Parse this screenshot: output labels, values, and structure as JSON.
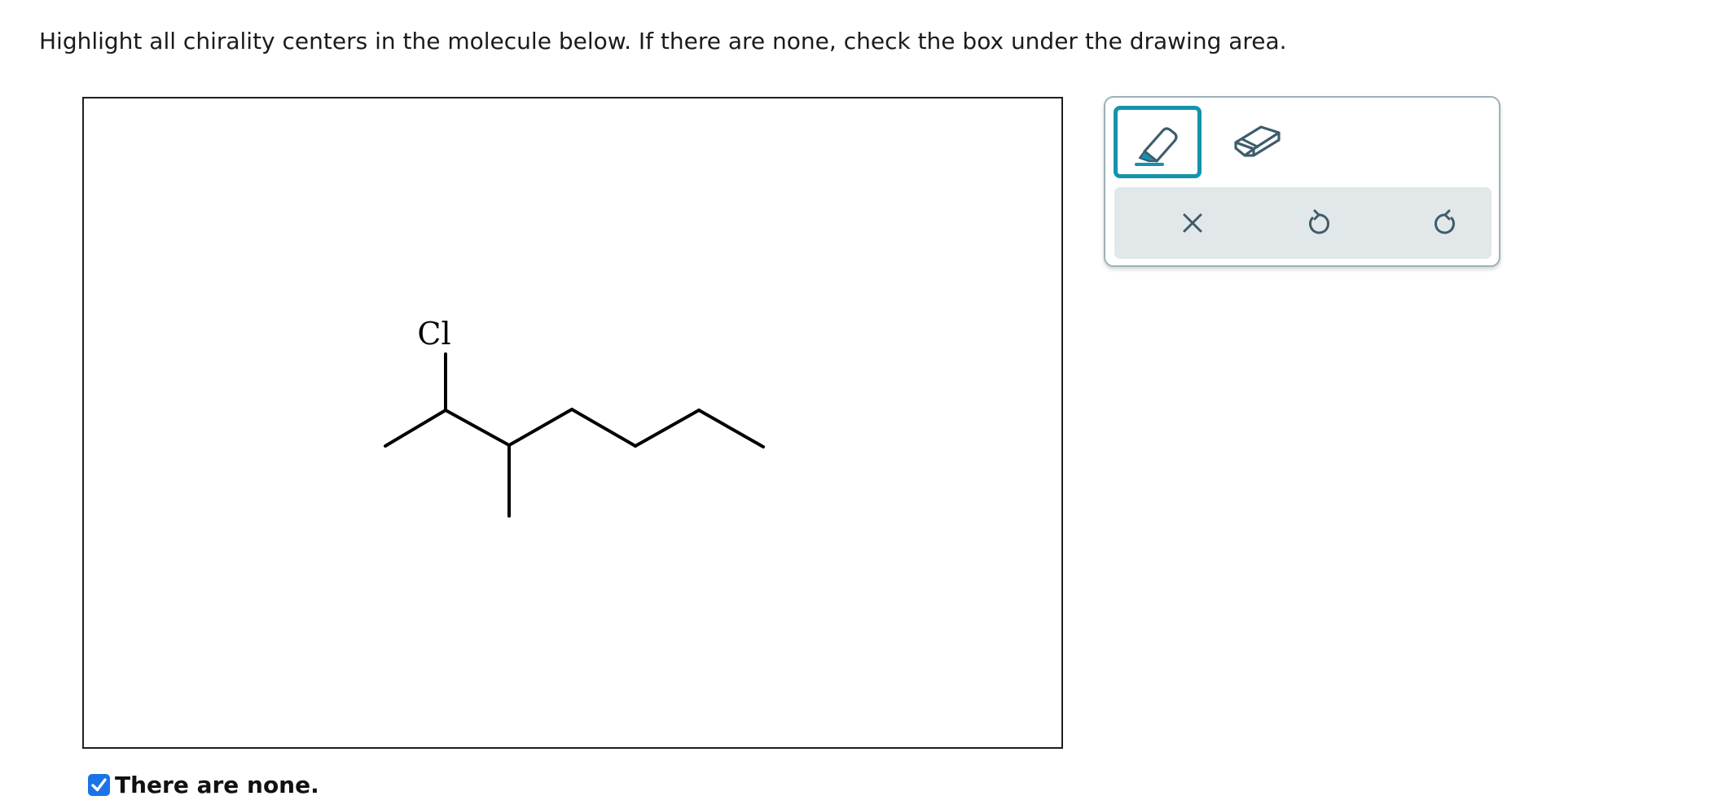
{
  "question": {
    "text": "Highlight all chirality centers in the molecule below. If there are none, check the box under the drawing area."
  },
  "molecule": {
    "atom_labels": [
      "Cl"
    ]
  },
  "none_option": {
    "label": "There are none.",
    "checked": true
  },
  "toolbox": {
    "tools": [
      "highlighter-icon",
      "eraser-icon"
    ],
    "selected_tool": "highlighter",
    "actions": [
      "clear-icon",
      "undo-icon",
      "redo-icon"
    ]
  },
  "colors": {
    "accent": "#1393ad",
    "checkbox": "#1a73e8",
    "icon": "#3e5d6b",
    "action_bar_bg": "#e2e7e9",
    "toolbox_border": "#9fb0b8"
  }
}
